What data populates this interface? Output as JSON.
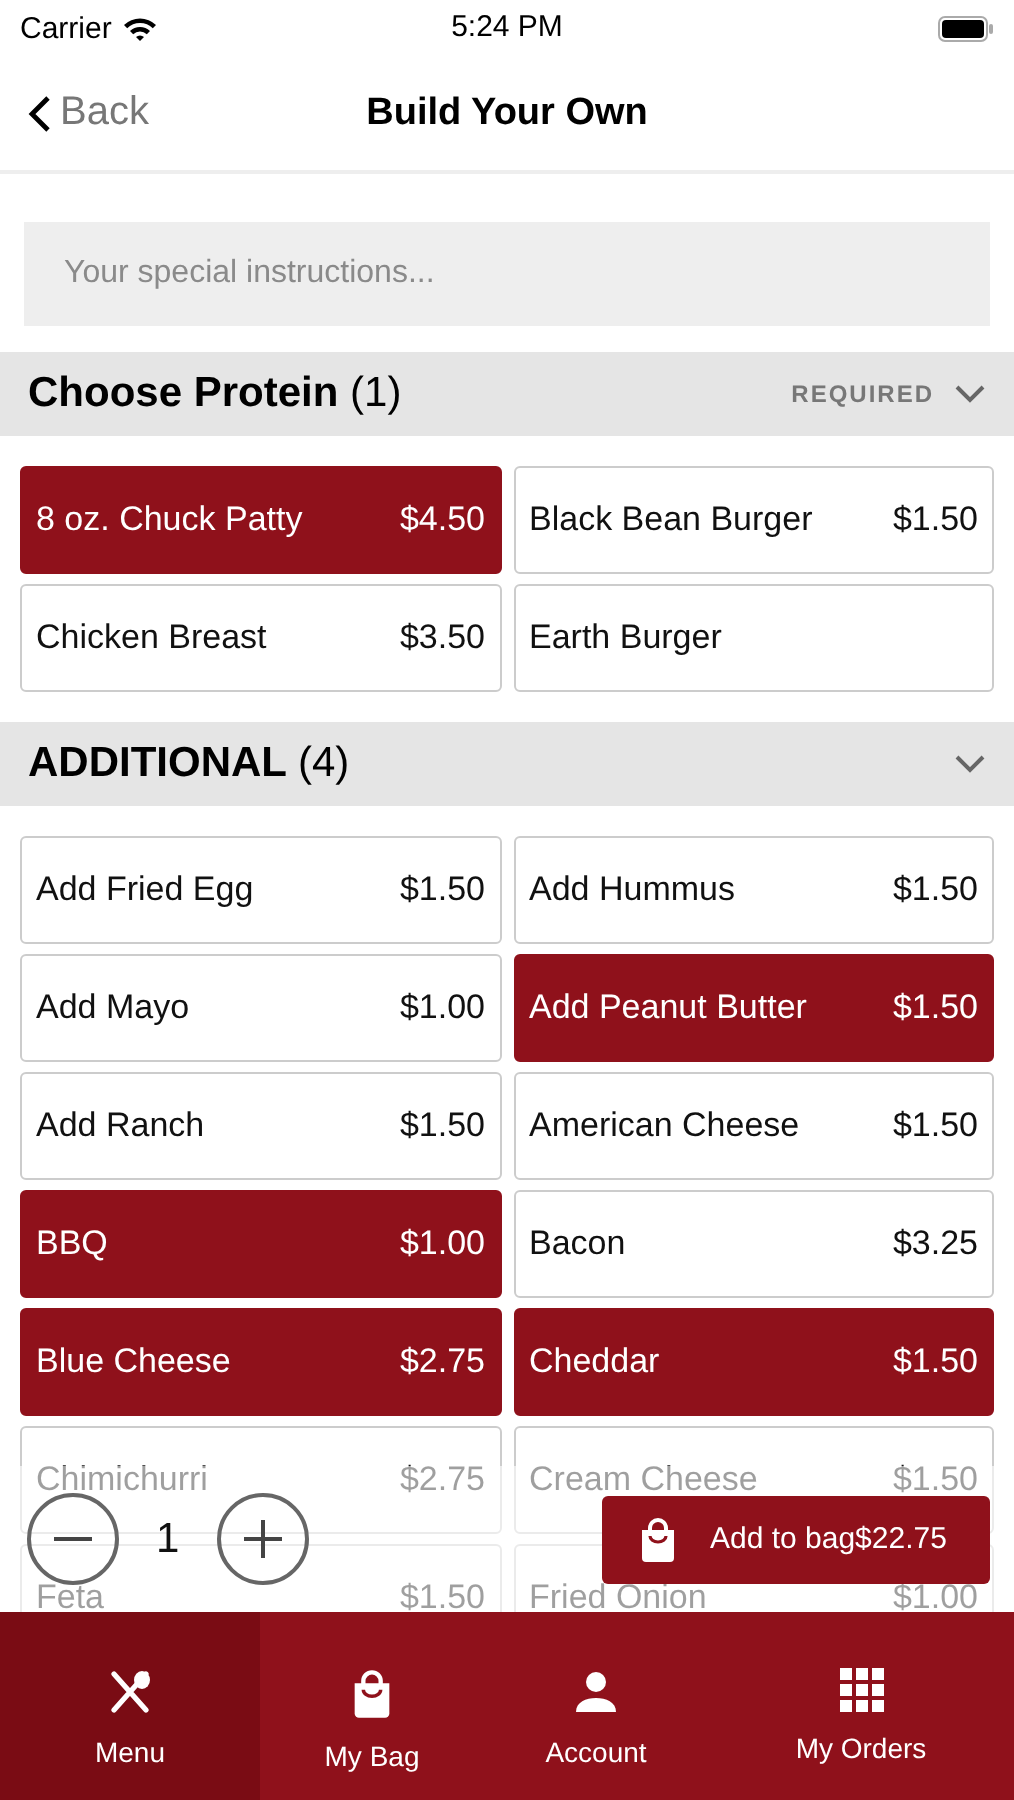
{
  "status_bar": {
    "carrier": "Carrier",
    "time": "5:24 PM"
  },
  "nav": {
    "back_label": "Back",
    "title": "Build Your Own"
  },
  "instructions": {
    "placeholder": "Your special instructions..."
  },
  "sections": [
    {
      "title": "Choose Protein",
      "count": "(1)",
      "badge": "REQUIRED",
      "options": [
        {
          "name": "8 oz. Chuck Patty",
          "price": "$4.50",
          "selected": true
        },
        {
          "name": "Black Bean Burger",
          "price": "$1.50",
          "selected": false
        },
        {
          "name": "Chicken Breast",
          "price": "$3.50",
          "selected": false
        },
        {
          "name": "Earth Burger",
          "selected": false
        }
      ]
    },
    {
      "title": "ADDITIONAL",
      "count": "(4)",
      "options": [
        {
          "name": "Add Fried Egg",
          "price": "$1.50",
          "selected": false
        },
        {
          "name": "Add Hummus",
          "price": "$1.50",
          "selected": false
        },
        {
          "name": "Add Mayo",
          "price": "$1.00",
          "selected": false
        },
        {
          "name": "Add Peanut Butter",
          "price": "$1.50",
          "selected": true
        },
        {
          "name": "Add Ranch",
          "price": "$1.50",
          "selected": false
        },
        {
          "name": "American Cheese",
          "price": "$1.50",
          "selected": false
        },
        {
          "name": "BBQ",
          "price": "$1.00",
          "selected": true
        },
        {
          "name": "Bacon",
          "price": "$3.25",
          "selected": false
        },
        {
          "name": "Blue Cheese",
          "price": "$2.75",
          "selected": true
        },
        {
          "name": "Cheddar",
          "price": "$1.50",
          "selected": true
        },
        {
          "name": "Chimichurri",
          "price": "$2.75",
          "selected": false
        },
        {
          "name": "Cream Cheese",
          "price": "$1.50",
          "selected": false
        },
        {
          "name": "Feta",
          "price": "$1.50",
          "selected": false
        },
        {
          "name": "Fried Onion",
          "price": "$1.00",
          "selected": false
        }
      ]
    }
  ],
  "quantity": {
    "value": "1"
  },
  "add_button": {
    "label": "Add to bag",
    "total": "$22.75"
  },
  "tabs": [
    {
      "label": "Menu",
      "selected": true
    },
    {
      "label": "My Bag",
      "selected": false
    },
    {
      "label": "Account",
      "selected": false
    },
    {
      "label": "My Orders",
      "selected": false
    }
  ]
}
